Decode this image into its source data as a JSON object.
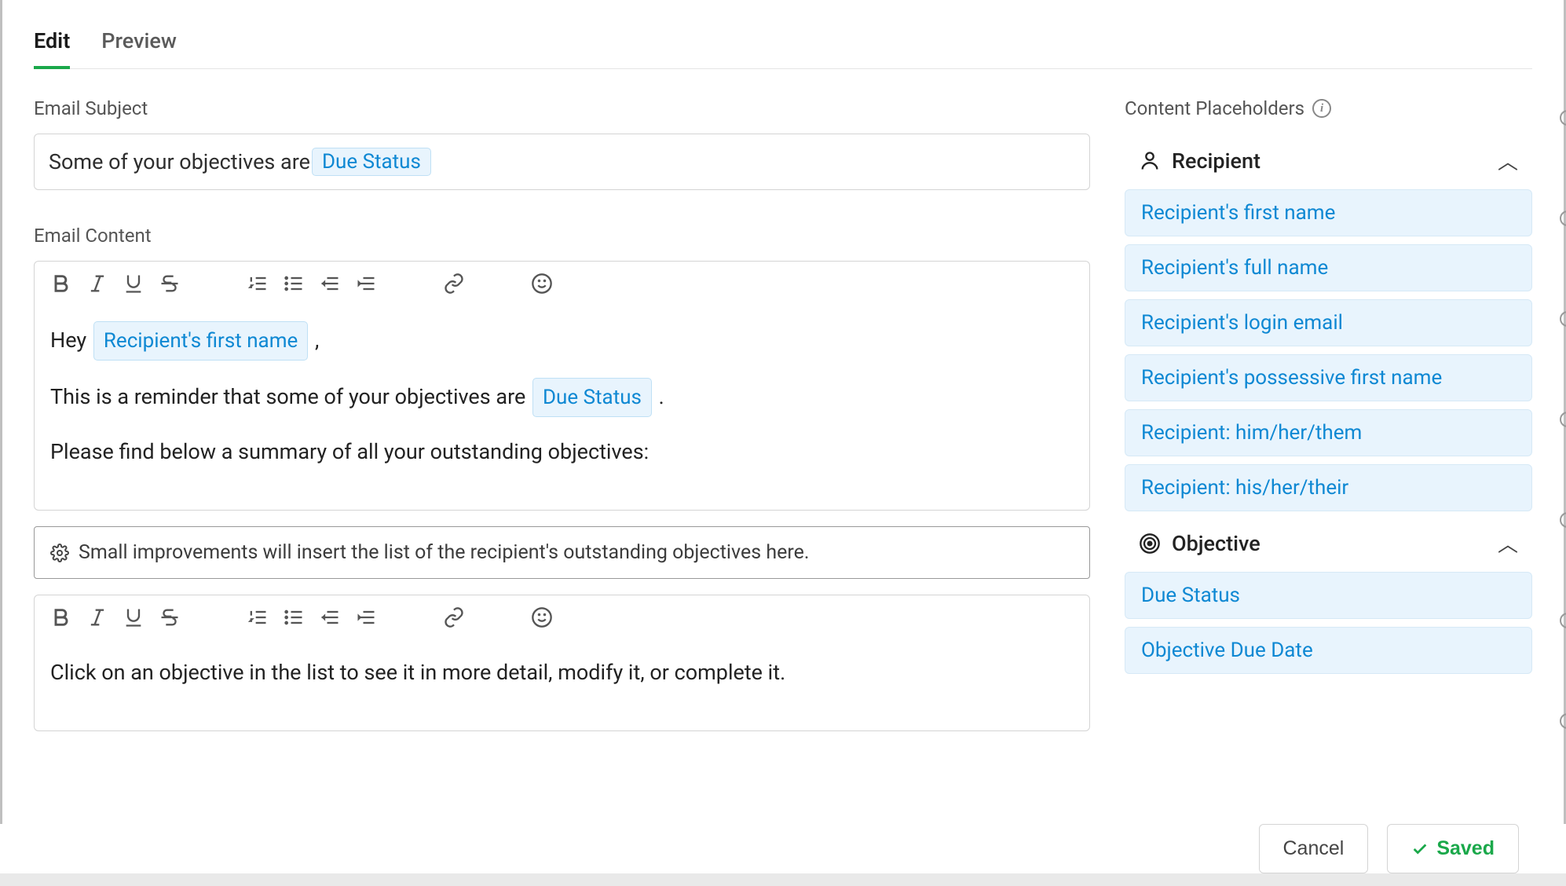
{
  "tabs": {
    "edit": "Edit",
    "preview": "Preview",
    "active": "edit"
  },
  "labels": {
    "subject": "Email Subject",
    "content": "Email Content",
    "placeholders": "Content Placeholders"
  },
  "subject": {
    "text_prefix": "Some of your objectives are ",
    "chip": "Due Status"
  },
  "body1": {
    "line1_prefix": "Hey ",
    "line1_chip": "Recipient's first name",
    "line1_suffix": " ,",
    "line2_prefix": "This is a reminder that some of your objectives are ",
    "line2_chip": "Due Status",
    "line2_suffix": " .",
    "line3": "Please find below a summary of all your outstanding objectives:"
  },
  "banner": "Small improvements will insert the list of the recipient's outstanding objectives here.",
  "body2": {
    "line1": "Click on an objective in the list to see it in more detail, modify it, or complete it."
  },
  "placeholders": {
    "recipient_title": "Recipient",
    "objective_title": "Objective",
    "recipient_items": [
      "Recipient's first name",
      "Recipient's full name",
      "Recipient's login email",
      "Recipient's possessive first name",
      "Recipient: him/her/them",
      "Recipient: his/her/their"
    ],
    "objective_items": [
      "Due Status",
      "Objective Due Date"
    ]
  },
  "footer": {
    "cancel": "Cancel",
    "saved": "Saved"
  }
}
